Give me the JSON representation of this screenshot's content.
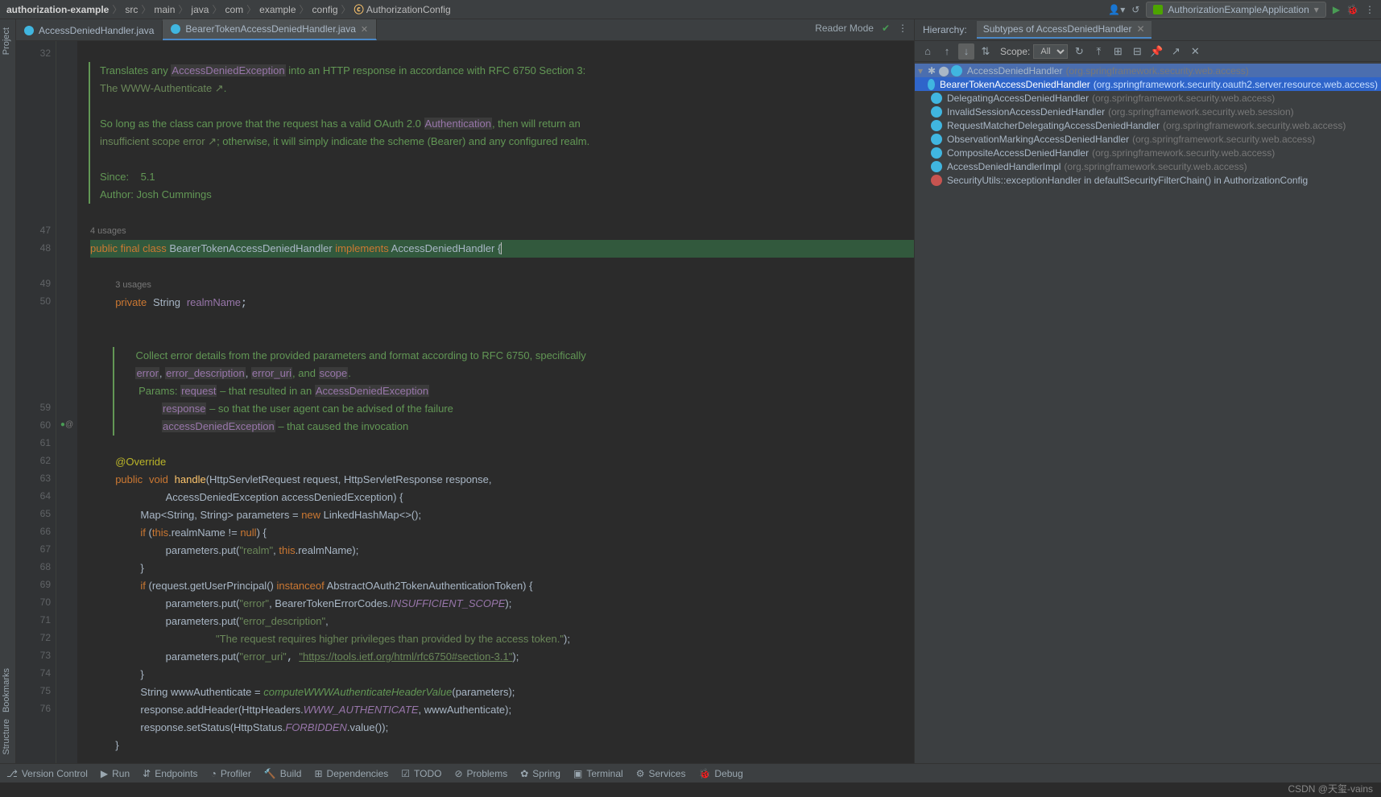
{
  "breadcrumbs": [
    "authorization-example",
    "src",
    "main",
    "java",
    "com",
    "example",
    "config",
    "AuthorizationConfig"
  ],
  "runConfig": "AuthorizationExampleApplication",
  "tabs": [
    {
      "label": "AccessDeniedHandler.java",
      "active": false
    },
    {
      "label": "BearerTokenAccessDeniedHandler.java",
      "active": true
    }
  ],
  "readerMode": "Reader Mode",
  "leftTabs": {
    "project": "Project",
    "bookmarks": "Bookmarks",
    "structure": "Structure"
  },
  "gutter": {
    "start": 32,
    "rows": [
      "32",
      "",
      "",
      "",
      "",
      "",
      "",
      "",
      "",
      "",
      "47",
      "48",
      "",
      "49",
      "50",
      "",
      "",
      "",
      "",
      "",
      "59",
      "60",
      "61",
      "62",
      "63",
      "64",
      "65",
      "66",
      "67",
      "68",
      "69",
      "70",
      "71",
      "72",
      "73",
      "74",
      "75",
      "76"
    ]
  },
  "gutterIcons": {
    "row60": "●! @"
  },
  "usages1": "4 usages",
  "usages2": "3 usages",
  "doc": {
    "l1a": "Translates any ",
    "l1b": "AccessDeniedException",
    "l1c": " into an HTTP response in accordance with ",
    "l1d": "RFC 6750 Section 3:",
    "l2": "The WWW-Authenticate ↗",
    "l3a": "So long as the class can prove that the request has a valid OAuth 2.0 ",
    "l3b": "Authentication",
    "l3c": ", then will return an ",
    "l4a": "insufficient scope error ↗",
    "l4b": "; otherwise, it will simply indicate the scheme (Bearer) and any configured realm.",
    "since": "Since:",
    "sinceV": "5.1",
    "author": "Author:",
    "authorV": "Josh Cummings",
    "c1": "Collect error details from the provided parameters and format according to RFC 6750, specifically",
    "c2a": "error",
    "c2b": "error_description",
    "c2c": "error_uri",
    "c2d": ", and ",
    "c2e": "scope",
    "p": "Params:",
    "p1a": "request",
    "p1b": " – that resulted in an ",
    "p1c": "AccessDeniedException",
    "p2a": "response",
    "p2b": " – so that the user agent can be advised of the failure",
    "p3a": "accessDeniedException",
    "p3b": " – that caused the invocation"
  },
  "code": {
    "public": "public",
    "final": "final",
    "class": "class",
    "className": "BearerTokenAccessDeniedHandler",
    "implements": "implements",
    "iface": "AccessDeniedHandler",
    "ob": "{",
    "private": "private",
    "String": "String",
    "realmName": "realmName",
    "override": "@Override",
    "void": "void",
    "handle": "handle",
    "args1": "(HttpServletRequest request, HttpServletResponse response,",
    "args2": "AccessDeniedException accessDeniedException) {",
    "map": "Map<String, String> parameters = ",
    "new": "new",
    "lhm": " LinkedHashMap<>();",
    "if": "if",
    "this": "this",
    "if1": " (",
    "if1b": ".realmName != ",
    "null": "null",
    "if1c": ") {",
    "put1a": "parameters.put(",
    "realm": "\"realm\"",
    "put1b": ", ",
    "put1c": ".realmName);",
    "cb": "}",
    "if2a": " (request.getUserPrincipal() ",
    "instanceof": "instanceof",
    "if2b": " AbstractOAuth2TokenAuthenticationToken) {",
    "put2a": "parameters.put(",
    "err": "\"error\"",
    "put2b": ", BearerTokenErrorCodes.",
    "iscope": "INSUFFICIENT_SCOPE",
    "put2c": ");",
    "put3": "parameters.put(",
    "errd": "\"error_description\"",
    "comma": ",",
    "msg": "\"The request requires higher privileges than provided by the access token.\"",
    "pc": ");",
    "put4": "parameters.put(",
    "erru": "\"error_uri\"",
    "uri": "\"https://tools.ietf.org/html/rfc6750#section-3.1\"",
    "wauth": "String wwwAuthenticate = ",
    "cwa": "computeWWWAuthenticateHeaderValue",
    "wauth2": "(parameters);",
    "addH": "response.addHeader(HttpHeaders.",
    "wwwa": "WWW_AUTHENTICATE",
    "addH2": ", wwwAuthenticate);",
    "setSt": "response.setStatus(HttpStatus.",
    "forb": "FORBIDDEN",
    "setSt2": ".value());"
  },
  "hierarchy": {
    "title": "Hierarchy:",
    "tab": "Subtypes of AccessDeniedHandler",
    "scope": "Scope:",
    "scopeVal": "All",
    "nodes": [
      {
        "level": 0,
        "name": "AccessDeniedHandler",
        "pkg": "(org.springframework.security.web.access)",
        "root": true
      },
      {
        "level": 1,
        "name": "BearerTokenAccessDeniedHandler",
        "pkg": "(org.springframework.security.oauth2.server.resource.web.access)",
        "selected": true
      },
      {
        "level": 1,
        "name": "DelegatingAccessDeniedHandler",
        "pkg": "(org.springframework.security.web.access)"
      },
      {
        "level": 1,
        "name": "InvalidSessionAccessDeniedHandler",
        "pkg": "(org.springframework.security.web.session)"
      },
      {
        "level": 1,
        "name": "RequestMatcherDelegatingAccessDeniedHandler",
        "pkg": "(org.springframework.security.web.access)"
      },
      {
        "level": 1,
        "name": "ObservationMarkingAccessDeniedHandler",
        "pkg": "(org.springframework.security.web.access)"
      },
      {
        "level": 1,
        "name": "CompositeAccessDeniedHandler",
        "pkg": "(org.springframework.security.web.access)"
      },
      {
        "level": 1,
        "name": "AccessDeniedHandlerImpl",
        "pkg": "(org.springframework.security.web.access)"
      },
      {
        "level": 1,
        "name": "SecurityUtils::exceptionHandler in defaultSecurityFilterChain() in AuthorizationConfig",
        "pkg": "",
        "red": true
      }
    ]
  },
  "bottom": [
    {
      "icon": "⎇",
      "label": "Version Control"
    },
    {
      "icon": "▶",
      "label": "Run"
    },
    {
      "icon": "⇵",
      "label": "Endpoints"
    },
    {
      "icon": "◔",
      "label": "Profiler"
    },
    {
      "icon": "🔨",
      "label": "Build"
    },
    {
      "icon": "⊞",
      "label": "Dependencies"
    },
    {
      "icon": "☑",
      "label": "TODO"
    },
    {
      "icon": "⊘",
      "label": "Problems"
    },
    {
      "icon": "✿",
      "label": "Spring"
    },
    {
      "icon": "▣",
      "label": "Terminal"
    },
    {
      "icon": "⚙",
      "label": "Services"
    },
    {
      "icon": "🐞",
      "label": "Debug"
    }
  ],
  "watermark": "CSDN @天玺-vains"
}
